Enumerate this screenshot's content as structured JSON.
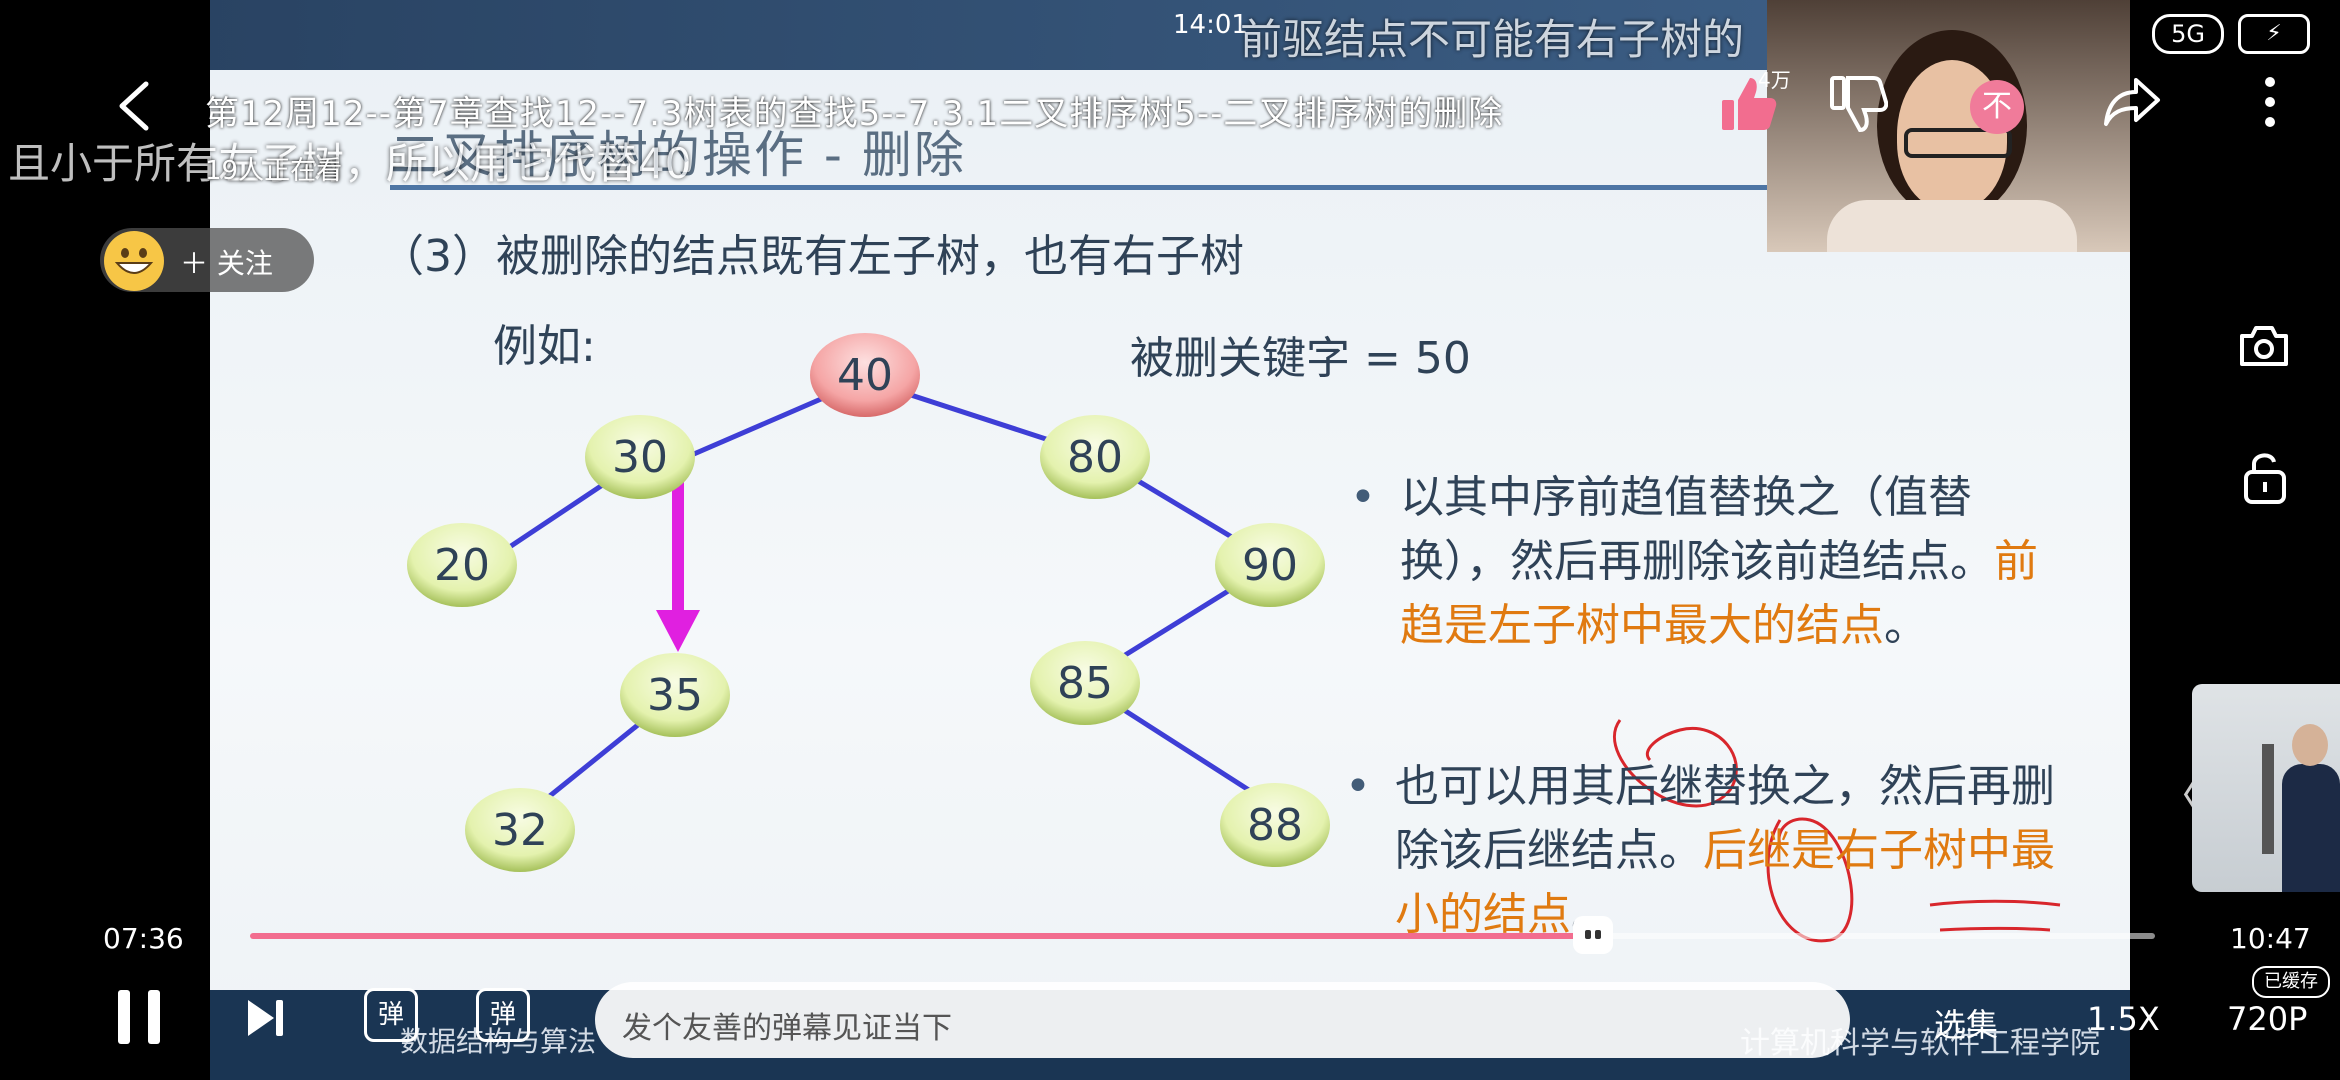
{
  "status_bar": {
    "time": "14:01",
    "network": "5G"
  },
  "danmaku": {
    "top_comment": "前驱结点不可能有右子树的",
    "left_comment": "且小于所有左子树，所以用它代替40"
  },
  "header": {
    "title": "第12周12--第7章查找12--7.3树表的查找5--7.3.1二叉排序树5--二叉排序树的删除",
    "viewers": "19人正在看",
    "follow_label": "关注",
    "like_count": "4万",
    "vip_label": "不"
  },
  "slide": {
    "title": "二叉排序树的操作 - 删除",
    "heading": "（3）被删除的结点既有左子树，也有右子树",
    "example_label": "例如:",
    "deleted_key": "被删关键字 = 50",
    "bullet1_text": "以其中序前趋值替换之（值替换），然后再删除该前趋结点。",
    "bullet1_highlight": "前趋是左子树中最大的结点",
    "bullet1_tail": "。",
    "bullet2_text": "也可以用其后继替换之，然后再删除该后继结点。",
    "bullet2_highlight": "后继是右子树中最小的结点",
    "bullet2_tail": "。",
    "course_footer": "数据结构与算法",
    "university_footer": "计算机科学与软件工程学院",
    "tree_nodes": [
      {
        "key": "40",
        "highlight": true
      },
      {
        "key": "30"
      },
      {
        "key": "80"
      },
      {
        "key": "20"
      },
      {
        "key": "90"
      },
      {
        "key": "35"
      },
      {
        "key": "85"
      },
      {
        "key": "32"
      },
      {
        "key": "88"
      }
    ]
  },
  "player": {
    "current_time": "07:36",
    "total_time": "10:47",
    "progress_fraction": 0.705,
    "danmaku_placeholder": "发个友善的弹幕见证当下",
    "danmaku_btn": "弹",
    "episodes_label": "选集",
    "speed_label": "1.5X",
    "quality_label": "720P",
    "cached_label": "已缓存"
  },
  "colors": {
    "accent": "#f26d8f",
    "node_fill": "#e6f3b5",
    "root_fill": "#f5a7a7",
    "edge": "#3e3ed6",
    "arrow": "#e020e0",
    "highlight": "#e07a10"
  }
}
